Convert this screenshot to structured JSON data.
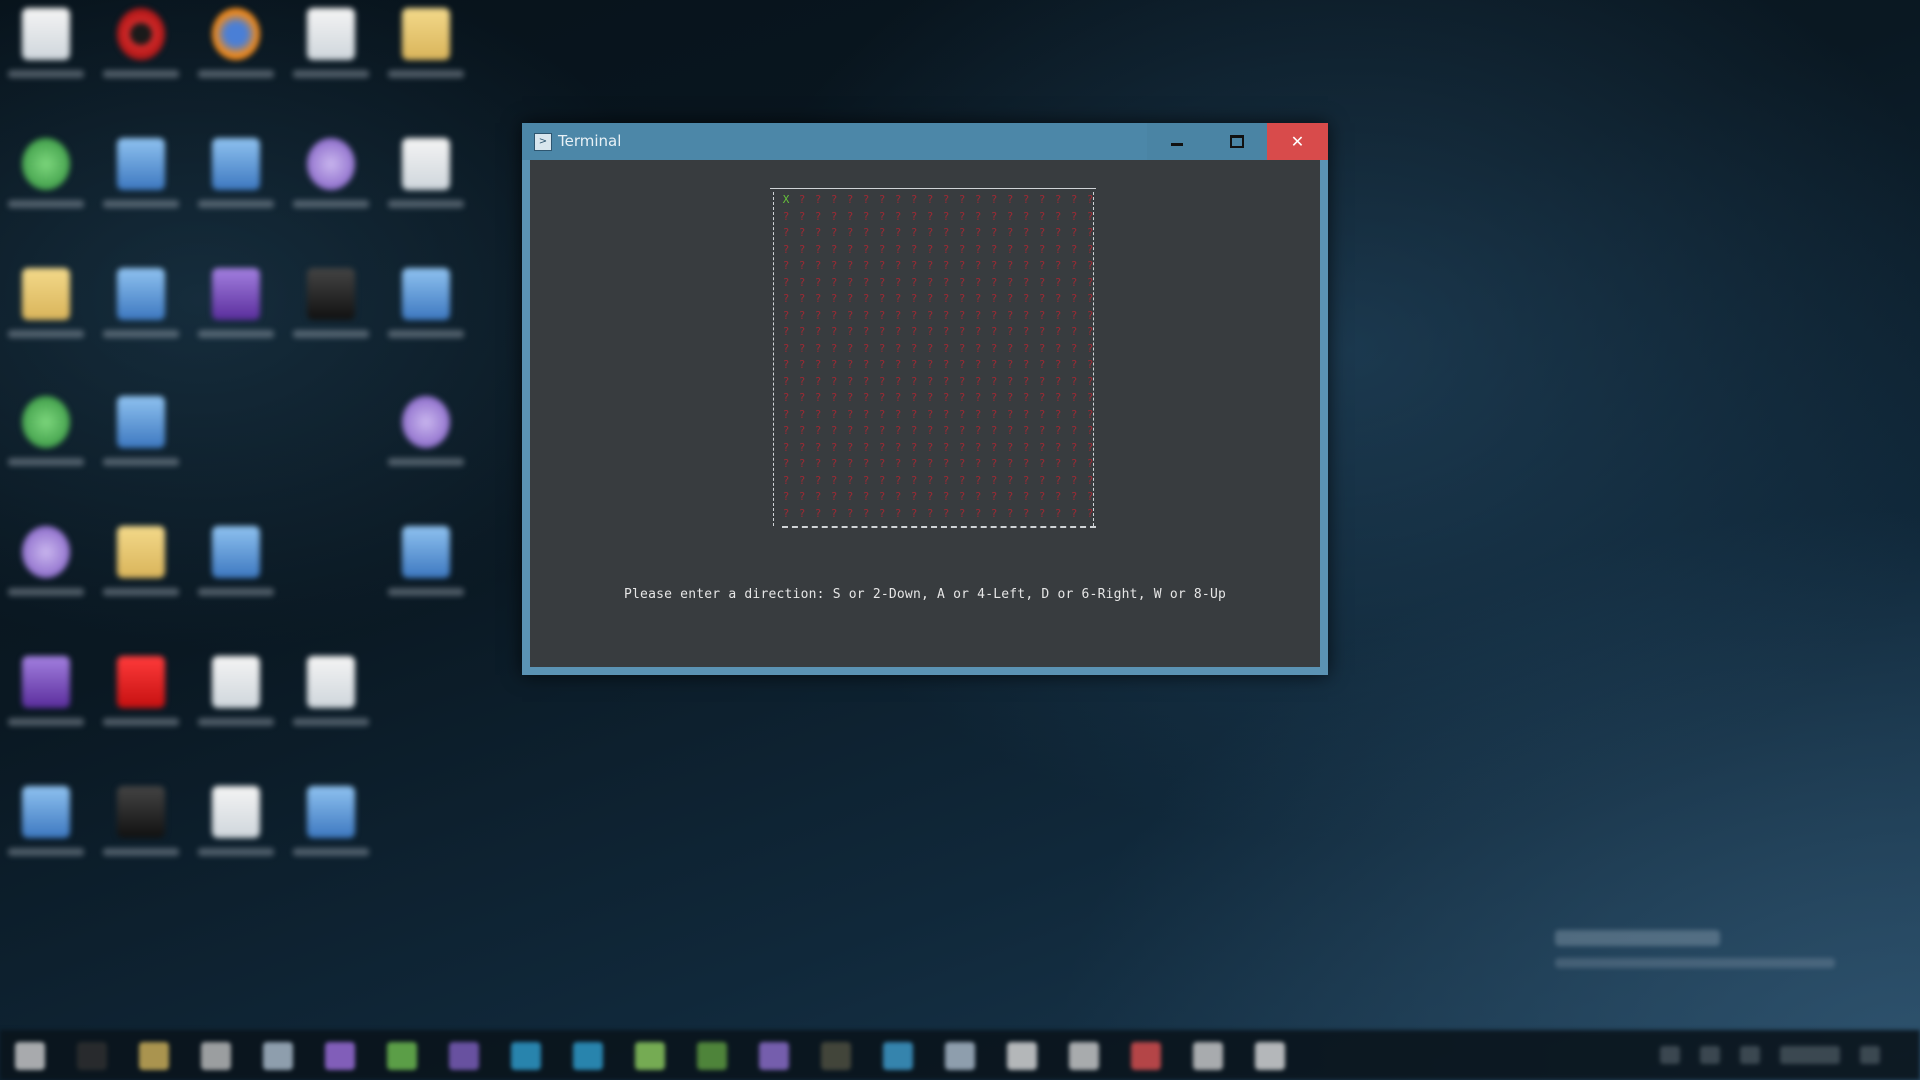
{
  "window": {
    "title": "Terminal",
    "minimize_label": "–",
    "close_label": "✕"
  },
  "game": {
    "player_symbol": "X",
    "cell_symbol": "?",
    "rows": 20,
    "cols": 20,
    "player_row": 0,
    "player_col": 0,
    "prompt": "Please enter a direction: S or 2-Down, A or 4-Left, D or 6-Right, W or 8-Up"
  },
  "colors": {
    "cell": "#9c2a34",
    "player": "#66c23a",
    "terminal_bg": "#383c3f",
    "titlebar": "#4c87a8",
    "close_button": "#d84b4b"
  },
  "desktop": {
    "icons": [
      "doc-icon",
      "opera-icon",
      "firefox-icon",
      "doc-icon",
      "folder-icon",
      "app-icon",
      "network-icon",
      "app-icon",
      "app-icon",
      "doc-icon",
      "folder-icon",
      "image-icon",
      "app-icon",
      "app-icon",
      "doc-icon",
      "app-icon",
      "app-icon",
      "app-icon",
      "app-icon",
      "folder-icon",
      "app-icon",
      "doc-icon",
      "app-icon",
      "app-icon",
      "doc-icon",
      "doc-icon",
      "doc-icon",
      "app-icon",
      "doc-icon",
      "doc-icon"
    ]
  },
  "taskbar": {
    "apps": [
      "start-icon",
      "search-icon",
      "explorer-icon",
      "app-icon",
      "app-icon",
      "app-icon",
      "app-icon",
      "app-icon",
      "app-icon",
      "app-icon",
      "app-icon",
      "app-icon",
      "app-icon",
      "app-icon",
      "app-icon",
      "app-icon",
      "app-icon",
      "app-icon",
      "chrome-icon",
      "app-icon",
      "terminal-icon"
    ]
  }
}
